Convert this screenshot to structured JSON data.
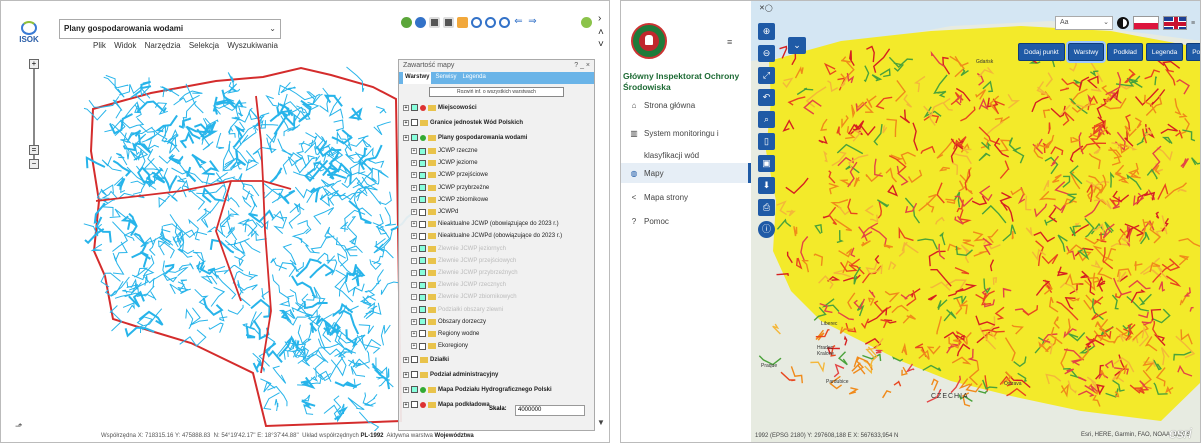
{
  "left": {
    "logo": "ISOK",
    "layer_select": "Plany gospodarowania wodami",
    "menu": [
      "Plik",
      "Widok",
      "Narzędzia",
      "Selekcja",
      "Wyszukiwania"
    ],
    "panel": {
      "title": "Zawartość mapy",
      "tabs": [
        "Warstwy",
        "Serwisy",
        "Legenda"
      ],
      "expand_button": "Rozwiń inf. o wszystkich warstwach",
      "layers": [
        {
          "label": "Miejscowości",
          "bold": true,
          "check": true,
          "dot": "#d33",
          "level": 0
        },
        {
          "label": "Granice jednostek Wód Polskich",
          "bold": true,
          "check": false,
          "dot": "",
          "level": 0
        },
        {
          "label": "Plany gospodarowania wodami",
          "bold": true,
          "check": true,
          "dot": "#3a3",
          "level": 0
        },
        {
          "label": "JCWP rzeczne",
          "bold": false,
          "check": true,
          "dot": "",
          "level": 1
        },
        {
          "label": "JCWP jeziorne",
          "bold": false,
          "check": true,
          "dot": "",
          "level": 1
        },
        {
          "label": "JCWP przejściowe",
          "bold": false,
          "check": true,
          "dot": "",
          "level": 1
        },
        {
          "label": "JCWP przybrzeżne",
          "bold": false,
          "check": true,
          "dot": "",
          "level": 1
        },
        {
          "label": "JCWP zbiornikowe",
          "bold": false,
          "check": true,
          "dot": "",
          "level": 1
        },
        {
          "label": "JCWPd",
          "bold": false,
          "check": false,
          "dot": "",
          "level": 1
        },
        {
          "label": "Nieaktualne JCWP (obowiązujące do 2023 r.)",
          "bold": false,
          "check": false,
          "dot": "",
          "level": 1
        },
        {
          "label": "Nieaktualne JCWPd (obowiązujące do 2023 r.)",
          "bold": false,
          "check": false,
          "dot": "",
          "level": 1
        },
        {
          "label": "Zlewnie JCWP jeziornych",
          "bold": false,
          "check": true,
          "dot": "",
          "level": 1,
          "dim": true
        },
        {
          "label": "Zlewnie JCWP przejściowych",
          "bold": false,
          "check": true,
          "dot": "",
          "level": 1,
          "dim": true
        },
        {
          "label": "Zlewnie JCWP przybrzeżnych",
          "bold": false,
          "check": true,
          "dot": "",
          "level": 1,
          "dim": true
        },
        {
          "label": "Zlewnie JCWP rzecznych",
          "bold": false,
          "check": true,
          "dot": "",
          "level": 1,
          "dim": true
        },
        {
          "label": "Zlewnie JCWP zbiornikowych",
          "bold": false,
          "check": true,
          "dot": "",
          "level": 1,
          "dim": true
        },
        {
          "label": "Podziałki obszary zlewni",
          "bold": false,
          "check": true,
          "dot": "",
          "level": 1,
          "dim": true
        },
        {
          "label": "Obszary dorzeczy",
          "bold": false,
          "check": true,
          "dot": "",
          "level": 1
        },
        {
          "label": "Regiony wodne",
          "bold": false,
          "check": false,
          "dot": "",
          "level": 1
        },
        {
          "label": "Ekoregiony",
          "bold": false,
          "check": false,
          "dot": "",
          "level": 1
        },
        {
          "label": "Działki",
          "bold": true,
          "check": false,
          "dot": "",
          "level": 0
        },
        {
          "label": "Podział administracyjny",
          "bold": true,
          "check": false,
          "dot": "",
          "level": 0
        },
        {
          "label": "Mapa Podziału Hydrograficznego Polski",
          "bold": true,
          "check": true,
          "dot": "#3a3",
          "level": 0
        },
        {
          "label": "Mapa podkładowa",
          "bold": true,
          "check": false,
          "dot": "#d33",
          "level": 0
        }
      ]
    },
    "scale_label": "Skala:",
    "scale_value": "4000000",
    "status": {
      "coord_label": "Współrzędna",
      "x": "X: 718315.16",
      "y": "Y: 475888.83",
      "n": "N: 54°19'42.17''",
      "e": "E: 18°37'44.88''",
      "system_label": "Układ współrzędnych",
      "system": "PL-1992",
      "active_label": "Aktywna warstwa",
      "active": "Województwa"
    }
  },
  "right": {
    "org_name": "Główny Inspektorat Ochrony Środowiska",
    "nav": [
      {
        "label": "Strona główna",
        "icon": "home-icon",
        "glyph": "⌂"
      },
      {
        "label": "System monitoringu i klasyfikacji wód",
        "icon": "building-icon",
        "glyph": "▥"
      },
      {
        "label": "Mapy",
        "icon": "globe-icon",
        "glyph": "◍"
      },
      {
        "label": "Mapa strony",
        "icon": "share-icon",
        "glyph": "<"
      },
      {
        "label": "Pomoc",
        "icon": "help-icon",
        "glyph": "?"
      }
    ],
    "font_select": "Aa",
    "buttons": [
      "Dodaj punkt",
      "Warstwy",
      "Podkład",
      "Legenda",
      "Pomiary"
    ],
    "active_button": "Warstwy",
    "coords": "1992 (EPSG 2180)  Y:  297608,188 E   X:  567633,954 N",
    "attribution": "Esri, HERE, Garmin, FAO, NOAA, USGS",
    "esri": "esri",
    "map_labels": [
      "Gdańsk",
      "CZECHIA",
      "Praque",
      "Pardubice",
      "Ostrava",
      "Hradec Kralove",
      "Liberec"
    ]
  }
}
